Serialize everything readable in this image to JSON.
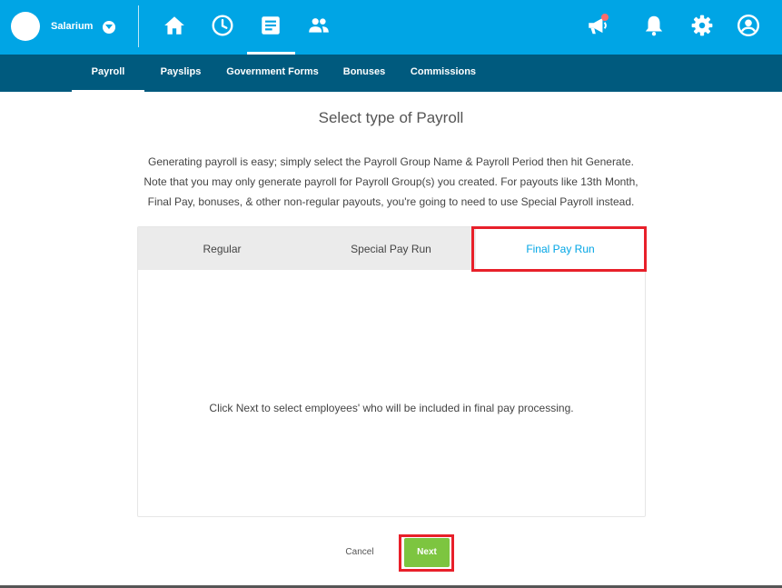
{
  "app": {
    "brand_name": "Salarium",
    "colors": {
      "primary": "#00a5e5",
      "subnav": "#005a7e",
      "accent_green": "#7dc540",
      "highlight_red": "#e8202a",
      "badge": "#ff6b6b"
    }
  },
  "topnav": {
    "icons": [
      "home-icon",
      "clock-icon",
      "document-icon",
      "people-icon"
    ],
    "active": "document-icon",
    "right_icons": [
      "megaphone-icon",
      "bell-icon",
      "gear-icon",
      "account-icon"
    ]
  },
  "subnav": {
    "tabs": [
      "Payroll",
      "Payslips",
      "Government Forms",
      "Bonuses",
      "Commissions"
    ],
    "active": "Payroll"
  },
  "main": {
    "title": "Select type of Payroll",
    "description": "Generating payroll is easy; simply select the Payroll Group Name & Payroll Period then hit Generate. Note that you may only generate payroll for Payroll Group(s) you created. For payouts like 13th Month, Final Pay, bonuses, & other non-regular payouts, you're going to need to use Special Payroll instead.",
    "tabs": [
      "Regular",
      "Special Pay Run",
      "Final Pay Run"
    ],
    "active_tab": "Final Pay Run",
    "message": "Click Next to select employees' who will be included in final pay processing."
  },
  "actions": {
    "cancel": "Cancel",
    "next": "Next"
  }
}
